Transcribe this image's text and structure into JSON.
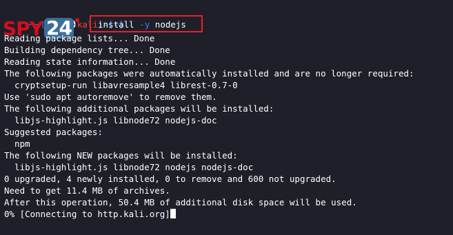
{
  "prompt": {
    "open": "┌──(",
    "user": "root💀kali",
    "close": ")-[~]"
  },
  "command": {
    "pre": "install ",
    "flag": "-y",
    "post": " nodejs"
  },
  "logo": {
    "brand": "SPY",
    "number": "24"
  },
  "output_lines": [
    "Reading package lists... Done",
    "Building dependency tree... Done",
    "Reading state information... Done",
    "The following packages were automatically installed and are no longer required:",
    "  cryptsetup-run libavresample4 librest-0.7-0",
    "Use 'sudo apt autoremove' to remove them.",
    "The following additional packages will be installed:",
    "  libjs-highlight.js libnode72 nodejs-doc",
    "Suggested packages:",
    "  npm",
    "The following NEW packages will be installed:",
    "  libjs-highlight.js libnode72 nodejs nodejs-doc",
    "0 upgraded, 4 newly installed, 0 to remove and 600 not upgraded.",
    "Need to get 11.4 MB of archives.",
    "After this operation, 50.4 MB of additional disk space will be used.",
    "0% [Connecting to http.kali.org]"
  ],
  "colors": {
    "background": "#1e1f29",
    "prompt": "#3b7bff",
    "user": "#ff3b3b",
    "highlight_box": "#e8212d",
    "logo_red": "#d10f1b"
  }
}
